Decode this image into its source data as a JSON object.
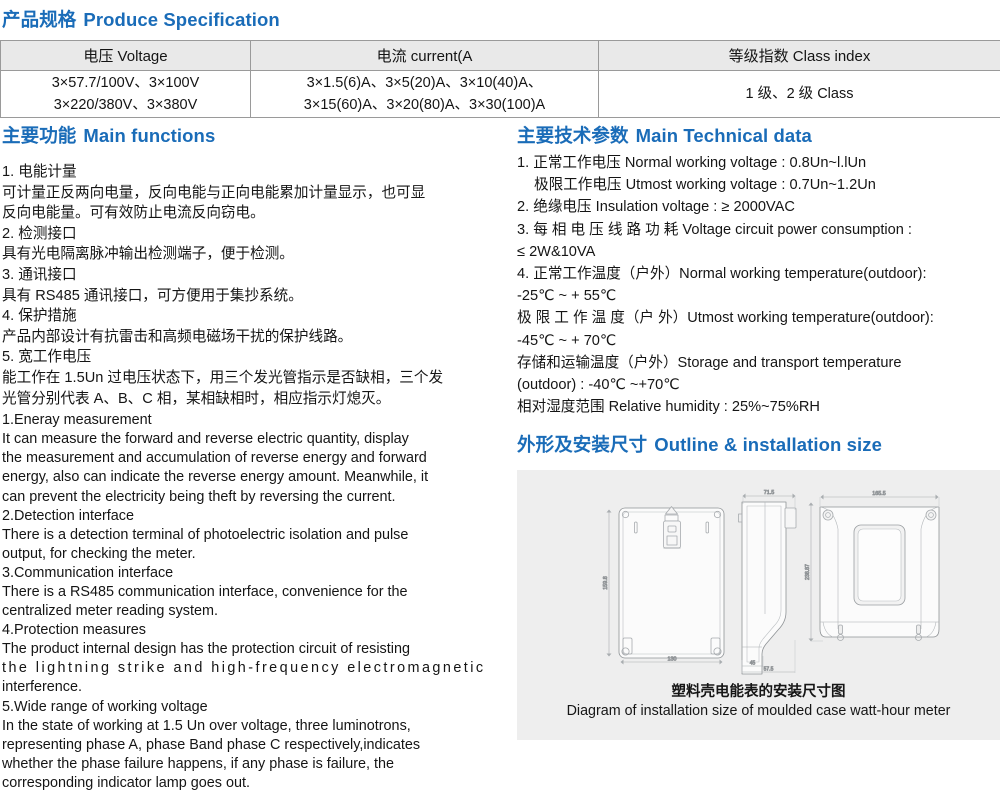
{
  "specification": {
    "heading_cn": "产品规格",
    "heading_en": "Produce Specification",
    "columns": [
      {
        "cn": "电压",
        "en": "Voltage"
      },
      {
        "cn": "电流",
        "en": "current(A"
      },
      {
        "cn": "等级指数",
        "en": "Class index"
      }
    ],
    "column_headers": [
      "电压 Voltage",
      "电流  current(A",
      "等级指数 Class index"
    ],
    "rows": [
      {
        "voltage": [
          "3×57.7/100V、3×100V",
          "3×220/380V、3×380V"
        ],
        "current": [
          "3×1.5(6)A、3×5(20)A、3×10(40)A、",
          "3×15(60)A、3×20(80)A、3×30(100)A"
        ],
        "class_index": [
          "1 级、2 级 Class"
        ]
      }
    ]
  },
  "main_functions": {
    "heading_cn": "主要功能",
    "heading_en": "Main functions",
    "cn_lines": [
      "1. 电能计量",
      "可计量正反两向电量，反向电能与正向电能累加计量显示，也可显",
      "反向电能量。可有效防止电流反向窃电。",
      "2. 检测接口",
      "具有光电隔离脉冲输出检测端子，便于检测。",
      "3. 通讯接口",
      "具有 RS485 通讯接口，可方便用于集抄系统。",
      "4. 保护措施",
      "产品内部设计有抗雷击和高频电磁场干扰的保护线路。",
      "5. 宽工作电压",
      "能工作在 1.5Un 过电压状态下，用三个发光管指示是否缺相，三个发",
      "光管分别代表 A、B、C 相，某相缺相时，相应指示灯熄灭。"
    ],
    "en_lines": [
      {
        "text": "1.Eneray measurement",
        "justify": false
      },
      {
        "text": "It can measure the forward and reverse electric quantity, display",
        "justify": false
      },
      {
        "text": "the measurement and accumulation of reverse energy and forward",
        "justify": false
      },
      {
        "text": "energy, also can indicate the reverse energy amount. Meanwhile, it",
        "justify": false
      },
      {
        "text": "can prevent the electricity being theft by reversing the current.",
        "justify": false
      },
      {
        "text": "2.Detection interface",
        "justify": false
      },
      {
        "text": "There is a detection terminal of photoelectric isolation and pulse",
        "justify": false
      },
      {
        "text": "output, for checking the meter.",
        "justify": false
      },
      {
        "text": "3.Communication interface",
        "justify": false
      },
      {
        "text": "There is a RS485 communication interface, convenience for the",
        "justify": false
      },
      {
        "text": "centralized meter reading system.",
        "justify": false
      },
      {
        "text": "4.Protection measures",
        "justify": false
      },
      {
        "text": "The product internal design has the protection circuit of resisting",
        "justify": false
      },
      {
        "text": "the lightning strike and high-frequency electromagnetic",
        "justify": true
      },
      {
        "text": "interference.",
        "justify": false
      },
      {
        "text": "5.Wide range of working voltage",
        "justify": false
      },
      {
        "text": "In the state of working at 1.5 Un over voltage, three luminotrons,",
        "justify": false
      },
      {
        "text": "representing phase A, phase Band phase C respectively,indicates",
        "justify": false
      },
      {
        "text": "whether the phase failure happens, if any phase is failure, the",
        "justify": false
      },
      {
        "text": "corresponding indicator lamp goes out.",
        "justify": false
      }
    ]
  },
  "technical_data": {
    "heading_cn": "主要技术参数",
    "heading_en": "Main Technical data",
    "lines": [
      {
        "text": "1. 正常工作电压 Normal working voltage : 0.8Un~l.lUn",
        "indent": false,
        "spread": false
      },
      {
        "text": "极限工作电压 Utmost working voltage : 0.7Un~1.2Un",
        "indent": true,
        "spread": false
      },
      {
        "text": "2. 绝缘电压 Insulation voltage : ≥ 2000VAC",
        "indent": false,
        "spread": false
      },
      {
        "text": "3. 每 相 电 压 线 路 功 耗 Voltage circuit power consumption :",
        "indent": false,
        "spread": false
      },
      {
        "text": "≤ 2W&10VA",
        "indent": false,
        "spread": false
      },
      {
        "text": "4. 正常工作温度（户外）Normal working temperature(outdoor):",
        "indent": false,
        "spread": false
      },
      {
        "text": "-25℃ ~ + 55℃",
        "indent": false,
        "spread": false
      },
      {
        "text": "极 限 工 作 温 度（户 外）Utmost working temperature(outdoor):",
        "indent": false,
        "spread": false
      },
      {
        "text": "-45℃ ~ + 70℃",
        "indent": false,
        "spread": false
      },
      {
        "text": "存储和运输温度（户外）Storage and transport temperature",
        "indent": false,
        "spread": false
      },
      {
        "text": "(outdoor) : -40℃ ~+70℃",
        "indent": false,
        "spread": false
      },
      {
        "text": "相对湿度范围 Relative humidity : 25%~75%RH",
        "indent": false,
        "spread": false
      }
    ]
  },
  "outline": {
    "heading_cn": "外形及安装尺寸",
    "heading_en": "Outline & installation size",
    "caption_cn": "塑料壳电能表的安装尺寸图",
    "caption_en": "Diagram of installation size of moulded case watt-hour meter",
    "dimensions": {
      "front_height": "159.8",
      "front_width": "130",
      "side_width": "71.5",
      "side_bottom_inner": "45",
      "side_bottom_outer": "57.5",
      "rear_width": "165.5",
      "rear_height": "238.87"
    },
    "views": [
      "front-view",
      "side-view",
      "rear-view"
    ]
  },
  "theme": {
    "heading_blue": "#1a6cb8",
    "text_black": "#151515",
    "table_header_bg": "#e9e9e9",
    "table_border": "#9a9a9a",
    "panel_bg": "#eeeeee",
    "drawing_line": "#8f9396"
  }
}
